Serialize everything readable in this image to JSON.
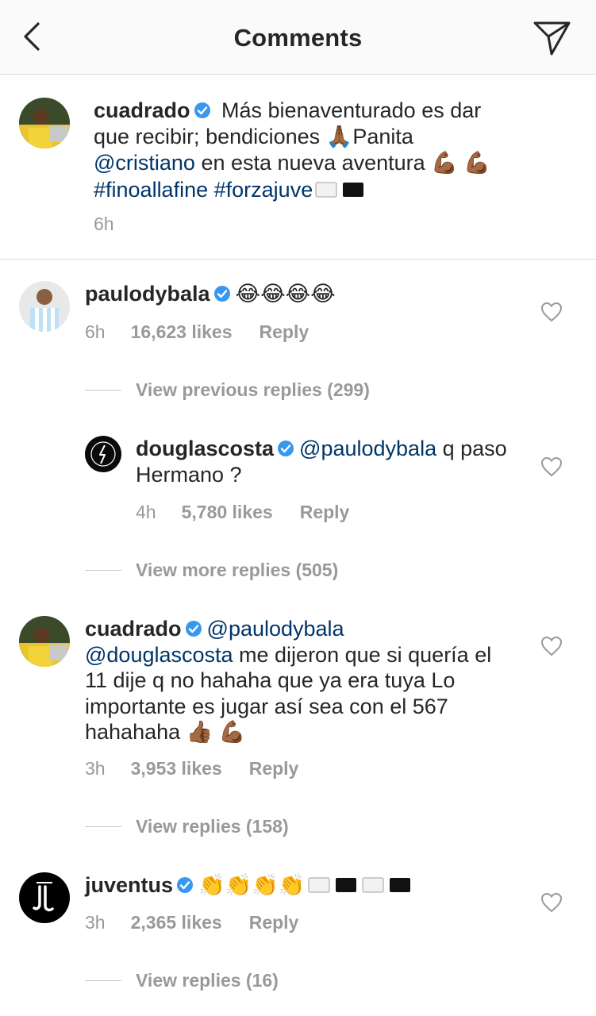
{
  "header": {
    "title": "Comments",
    "back_icon": "chevron-left-icon",
    "share_icon": "paper-plane-icon"
  },
  "caption": {
    "username": "cuadrado",
    "text_1": " Más bienaventurado es dar que recibir; bendiciones ",
    "text_2": "Panita ",
    "mention": "@cristiano",
    "text_3": " en esta nueva aventura ",
    "hashtag_1": "#finoallafine",
    "hashtag_2": "#forzajuve",
    "time": "6h"
  },
  "comments": [
    {
      "username": "paulodybala",
      "emoji": "😂😂😂😂",
      "time": "6h",
      "likes": "16,623 likes",
      "reply": "Reply",
      "view_replies": "View previous replies (299)"
    },
    {
      "username": "douglascosta",
      "mention": "@paulodybala",
      "text": " q paso Hermano ?",
      "time": "4h",
      "likes": "5,780 likes",
      "reply": "Reply",
      "view_replies": "View more replies (505)"
    },
    {
      "username": "cuadrado",
      "mention_1": "@paulodybala",
      "mention_2": "@douglascosta",
      "text": "  me dijeron que si quería el 11 dije q no hahaha  que ya era tuya Lo importante es jugar así sea con el 567 hahahaha ",
      "time": "3h",
      "likes": "3,953 likes",
      "reply": "Reply",
      "view_replies": "View replies (158)"
    },
    {
      "username": "juventus",
      "emoji": "👏👏👏👏",
      "time": "3h",
      "likes": "2,365 likes",
      "reply": "Reply",
      "view_replies": "View replies (16)"
    }
  ],
  "colors": {
    "link": "#003569",
    "verified": "#3897f0",
    "secondary_text": "#999999",
    "divider": "#dbdbdb"
  }
}
